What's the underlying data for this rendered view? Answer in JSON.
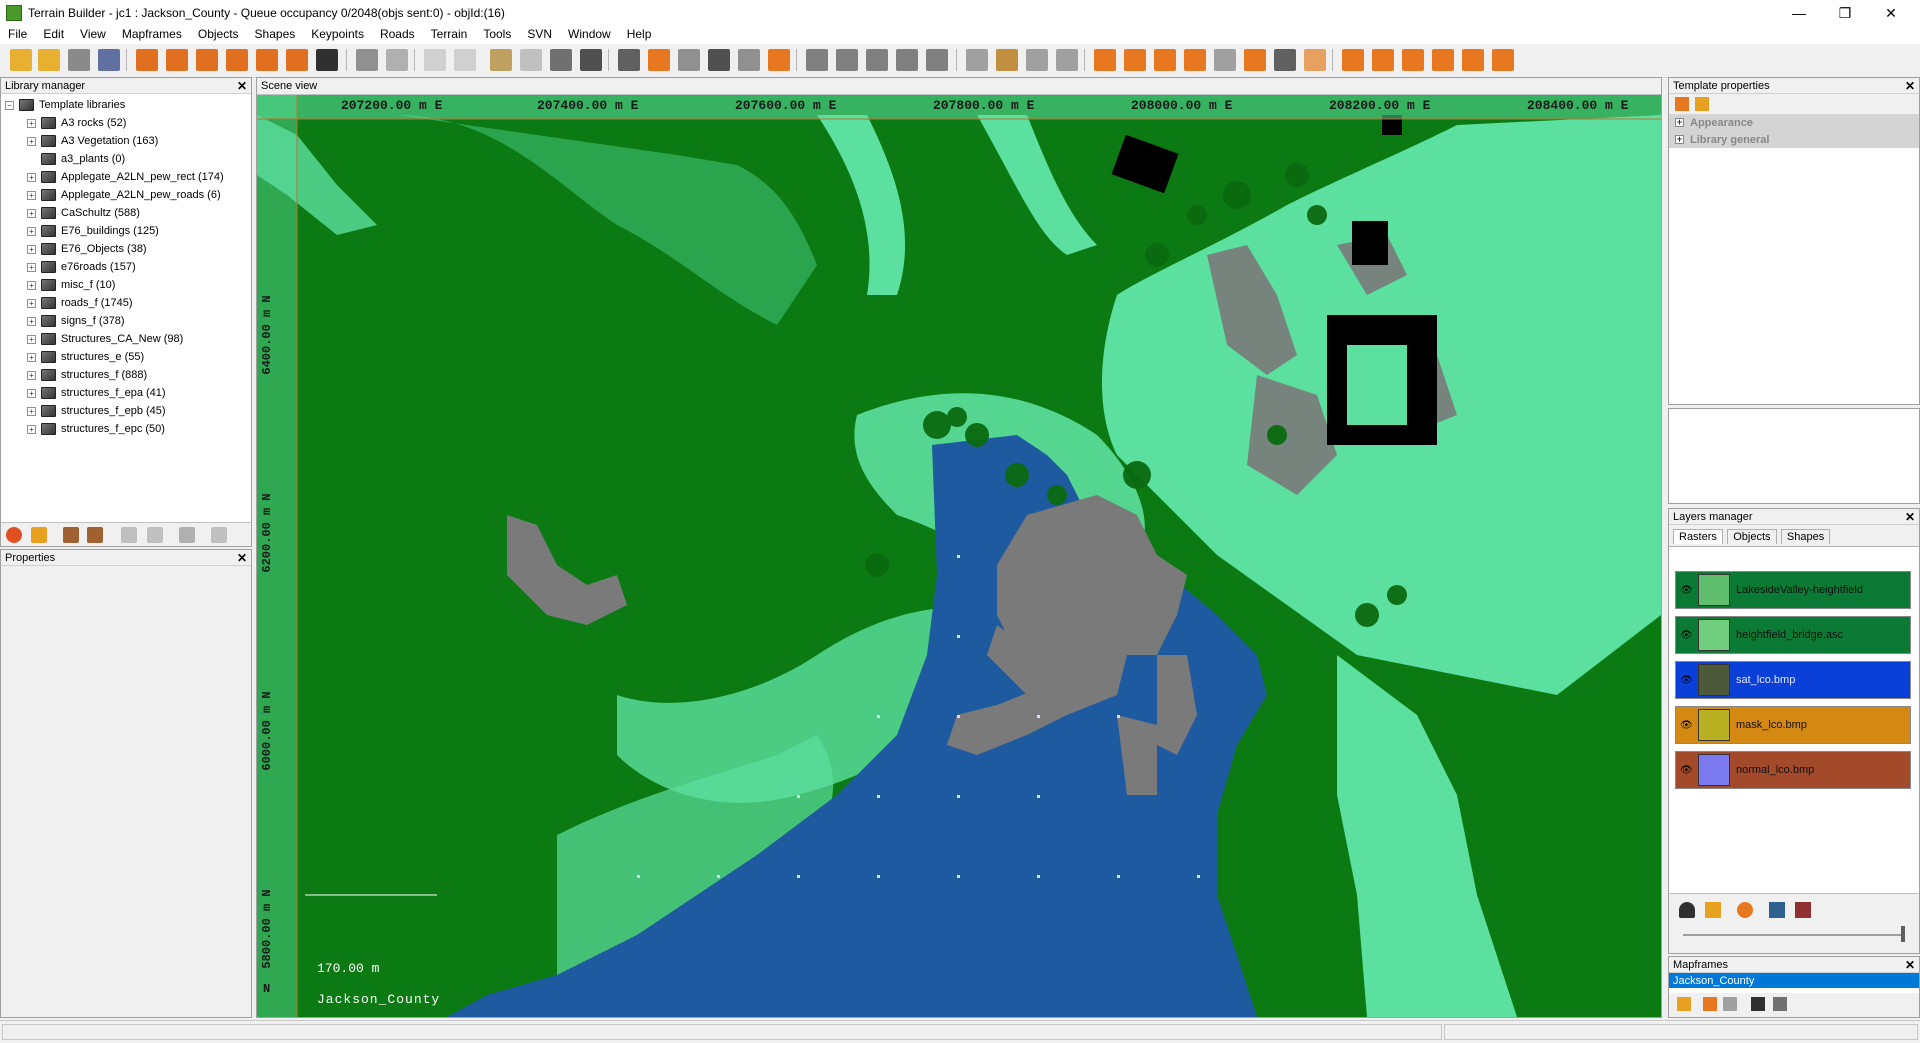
{
  "window": {
    "title": "Terrain Builder - jc1 : Jackson_County - Queue occupancy 0/2048(objs sent:0) - objId:(16)",
    "minimize": "—",
    "maximize": "❐",
    "close": "✕"
  },
  "menu": [
    "File",
    "Edit",
    "View",
    "Mapframes",
    "Objects",
    "Shapes",
    "Keypoints",
    "Roads",
    "Terrain",
    "Tools",
    "SVN",
    "Window",
    "Help"
  ],
  "library_manager": {
    "title": "Library manager",
    "root": "Template libraries",
    "items": [
      "A3 rocks (52)",
      "A3 Vegetation (163)",
      "a3_plants (0)",
      "Applegate_A2LN_pew_rect (174)",
      "Applegate_A2LN_pew_roads (6)",
      "CaSchultz (588)",
      "E76_buildings (125)",
      "E76_Objects (38)",
      "e76roads (157)",
      "misc_f (10)",
      "roads_f (1745)",
      "signs_f (378)",
      "Structures_CA_New (98)",
      "structures_e (55)",
      "structures_f (888)",
      "structures_f_epa (41)",
      "structures_f_epb (45)",
      "structures_f_epc (50)"
    ]
  },
  "properties_panel": {
    "title": "Properties"
  },
  "scene_view": {
    "title": "Scene view",
    "x_labels": [
      "207200.00 m E",
      "207400.00 m E",
      "207600.00 m E",
      "207800.00 m E",
      "208000.00 m E",
      "208200.00 m E",
      "208400.00 m E"
    ],
    "y_labels": [
      "6400.00 m N",
      "6200.00 m N",
      "6000.00 m N",
      "5800.00 m N",
      "N"
    ],
    "scale_text": "170.00 m",
    "mapframe_label": "Jackson_County"
  },
  "template_properties": {
    "title": "Template properties",
    "sections": [
      "Appearance",
      "Library general"
    ]
  },
  "layers_manager": {
    "title": "Layers manager",
    "tabs": [
      "Rasters",
      "Objects",
      "Shapes"
    ],
    "active_tab": "Rasters",
    "layers": [
      {
        "name": "LakesideValley-heightfield",
        "color": "#0b7a35",
        "thumb": "#5fbf6f"
      },
      {
        "name": "heightfield_bridge.asc",
        "color": "#0b7a35",
        "thumb": "#6fcf7f"
      },
      {
        "name": "sat_lco.bmp",
        "color": "#0a3fd8",
        "thumb": "#4c5a3a"
      },
      {
        "name": "mask_lco.bmp",
        "color": "#d48a12",
        "thumb": "#b8b020"
      },
      {
        "name": "normal_lco.bmp",
        "color": "#a34a2a",
        "thumb": "#7a7aee"
      }
    ]
  },
  "mapframes": {
    "title": "Mapframes",
    "items": [
      "Jackson_County"
    ]
  },
  "colors": {
    "forest": "#0b7a12",
    "grass": "#5ce0a0",
    "water": "#1e5aa0",
    "road": "#7a7a7a",
    "building": "#000000"
  }
}
